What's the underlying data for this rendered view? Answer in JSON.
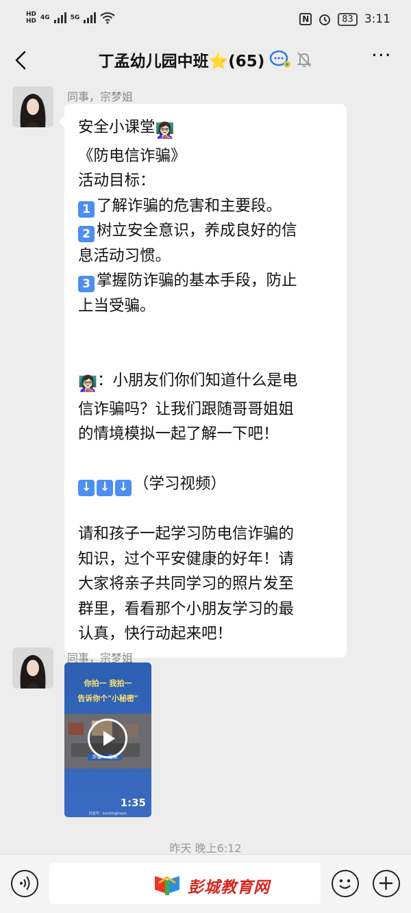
{
  "status_bar": {
    "sim1": "HD",
    "sim2": "HD",
    "net1": "4G",
    "net2": "5G",
    "nfc": "N",
    "battery": "83",
    "time": "3:11"
  },
  "nav": {
    "title": "丁孟幼儿园中班⭐(65)",
    "more": "···"
  },
  "messages": [
    {
      "sender": "同事，宗梦姐",
      "lines": [
        {
          "text": "安全小课堂",
          "suffix_emoji": "👩🏻‍🏫"
        },
        {
          "text": "《防电信诈骗》"
        },
        {
          "text": "活动目标："
        },
        {
          "num": "1",
          "text": "了解诈骗的危害和主要段。"
        },
        {
          "num": "2",
          "text": "树立安全意识，养成良好的信"
        },
        {
          "text": "息活动习惯。"
        },
        {
          "num": "3",
          "text": "掌握防诈骗的基本手段，防止"
        },
        {
          "text": "上当受骗。"
        },
        {
          "text": " "
        },
        {
          "text": " "
        },
        {
          "prefix_emoji": "👩🏻‍🏫",
          "text": "：小朋友们你们知道什么是电"
        },
        {
          "text": "信诈骗吗？让我们跟随哥哥姐姐"
        },
        {
          "text": "的情境模拟一起了解一下吧！"
        },
        {
          "text": " "
        },
        {
          "arrows": 3,
          "text": "（学习视频）"
        },
        {
          "text": " "
        },
        {
          "text": "请和孩子一起学习防电信诈骗的"
        },
        {
          "text": "知识，过个平安健康的好年！请"
        },
        {
          "text": "大家将亲子共同学习的照片发至"
        },
        {
          "text": "群里，看看那个小朋友学习的最"
        },
        {
          "text": "认真，快行动起来吧！"
        }
      ]
    },
    {
      "sender": "同事，宗梦姐",
      "video": {
        "banner_line1": "你拍一 我拍一",
        "banner_line2": "告诉你个\"小秘密\"",
        "caption": "诈骗一 视频",
        "duration": "1:35",
        "watermark": "抖音号：baodingjingan"
      }
    }
  ],
  "timestamp": "昨天 晚上6:12",
  "input_bar": {
    "watermark_text": "彭城教育网"
  },
  "colors": {
    "background": "#ededed",
    "bubble": "#ffffff",
    "number_box": "#4d8ff0",
    "watermark_red": "#d7261e"
  }
}
